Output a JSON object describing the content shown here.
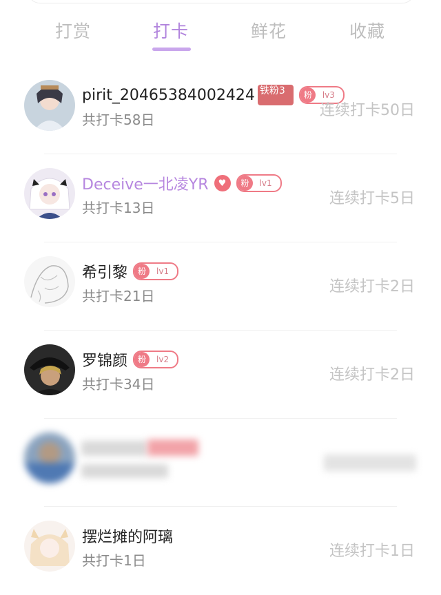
{
  "tabs": [
    {
      "label": "打赏",
      "active": false
    },
    {
      "label": "打卡",
      "active": true
    },
    {
      "label": "鲜花",
      "active": false
    },
    {
      "label": "收藏",
      "active": false
    }
  ],
  "colors": {
    "accent": "#b184dd",
    "fan_badge": "#ef7a86",
    "iron_badge": "#d96c6f",
    "muted_text": "#c4c4c4"
  },
  "users": [
    {
      "name": "pirit_20465384002424",
      "iron_badge": "铁粉3",
      "fan_label": "粉",
      "level": "lv3",
      "total": "共打卡58日",
      "streak": "连续打卡50日"
    },
    {
      "name": "Deceive一北凌YR",
      "heart": "♥",
      "fan_label": "粉",
      "level": "lv1",
      "total": "共打卡13日",
      "streak": "连续打卡5日"
    },
    {
      "name": "希引黎",
      "fan_label": "粉",
      "level": "lv1",
      "total": "共打卡21日",
      "streak": "连续打卡2日"
    },
    {
      "name": "罗锦颜",
      "fan_label": "粉",
      "level": "lv2",
      "total": "共打卡34日",
      "streak": "连续打卡2日"
    },
    {
      "blurred": true
    },
    {
      "name": "摆烂摊的阿璃",
      "total": "共打卡1日",
      "streak": "连续打卡1日"
    }
  ]
}
